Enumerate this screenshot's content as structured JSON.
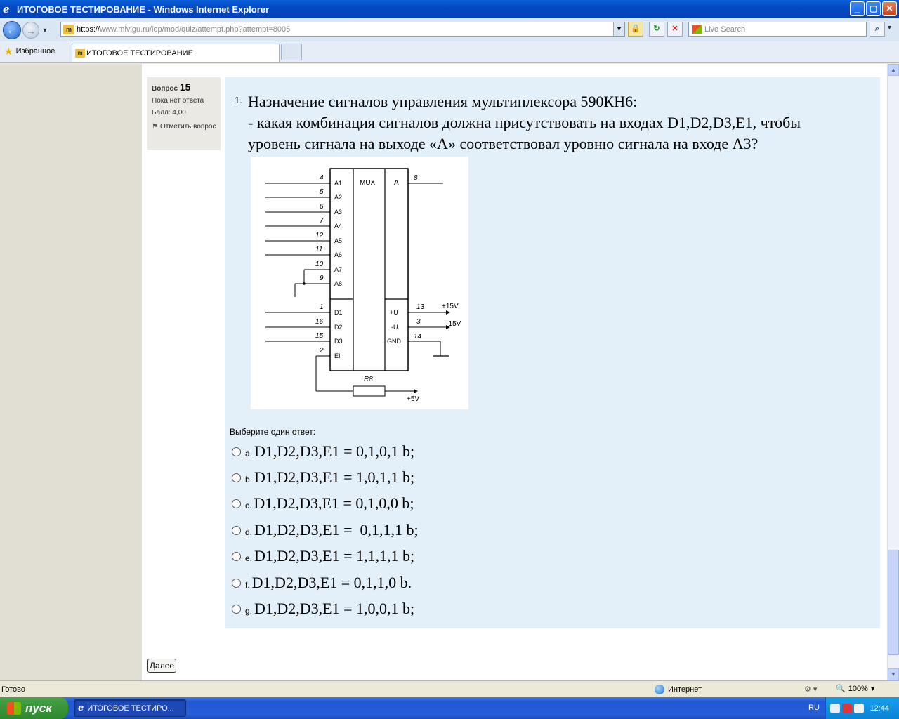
{
  "window": {
    "title": "ИТОГОВОЕ ТЕСТИРОВАНИЕ - Windows Internet Explorer",
    "minimize": "_",
    "maximize": "▢",
    "close": "✕"
  },
  "address": {
    "url_prefix": "https://",
    "url_host": "www.mivlgu.ru",
    "url_path": "/iop/mod/quiz/attempt.php?attempt=8005",
    "search_placeholder": "Live Search"
  },
  "tabs": {
    "favorites_label": "Избранное",
    "active_tab_title": "ИТОГОВОЕ ТЕСТИРОВАНИЕ"
  },
  "question_info": {
    "label": "Вопрос",
    "number": "15",
    "status": "Пока нет ответа",
    "score": "Балл: 4,00",
    "flag_label": "Отметить вопрос"
  },
  "question": {
    "list_number": "1.",
    "lines": [
      "Назначение сигналов управления мультиплексора 590КН6:",
      "- какая комбинация сигналов должна присутствовать на входах D1,D2,D3,E1, чтобы",
      "уровень сигнала на выходе «А» соответствовал уровню сигнала на входе А3?"
    ],
    "prompt": "Выберите один ответ:",
    "options": [
      {
        "letter": "a.",
        "text": "D1,D2,D3,E1 = 0,1,0,1 b;"
      },
      {
        "letter": "b.",
        "text": "D1,D2,D3,E1 = 1,0,1,1 b;"
      },
      {
        "letter": "c.",
        "text": "D1,D2,D3,E1 = 0,1,0,0 b;"
      },
      {
        "letter": "d.",
        "text": "D1,D2,D3,E1 =  0,1,1,1 b;"
      },
      {
        "letter": "e.",
        "text": "D1,D2,D3,E1 = 1,1,1,1 b;"
      },
      {
        "letter": "f.",
        "text": "D1,D2,D3,E1 = 0,1,1,0 b."
      },
      {
        "letter": "g.",
        "text": "D1,D2,D3,E1 = 1,0,0,1 b;"
      }
    ],
    "next_button": "Далее"
  },
  "diagram": {
    "chip_label": "MUX",
    "output_label": "A",
    "output_pin": "8",
    "address_inputs": [
      {
        "pin": "4",
        "label": "A1"
      },
      {
        "pin": "5",
        "label": "A2"
      },
      {
        "pin": "6",
        "label": "A3"
      },
      {
        "pin": "7",
        "label": "A4"
      },
      {
        "pin": "12",
        "label": "A5"
      },
      {
        "pin": "11",
        "label": "A6"
      },
      {
        "pin": "10",
        "label": "A7"
      },
      {
        "pin": "9",
        "label": "A8"
      }
    ],
    "control_inputs": [
      {
        "pin": "1",
        "label": "D1"
      },
      {
        "pin": "16",
        "label": "D2"
      },
      {
        "pin": "15",
        "label": "D3"
      },
      {
        "pin": "2",
        "label": "EI"
      }
    ],
    "power_pins": [
      {
        "pin": "13",
        "label": "+U",
        "supply": "+15V"
      },
      {
        "pin": "3",
        "label": "-U",
        "supply": "–15V"
      },
      {
        "pin": "14",
        "label": "GND",
        "supply": ""
      }
    ],
    "resistor_label": "R8",
    "resistor_supply": "+5V"
  },
  "status_bar": {
    "status": "Готово",
    "zone": "Интернет",
    "zoom": "100%"
  },
  "taskbar": {
    "start_label": "пуск",
    "task_label": "ИТОГОВОЕ ТЕСТИРО...",
    "language": "RU",
    "clock": "12:44"
  }
}
